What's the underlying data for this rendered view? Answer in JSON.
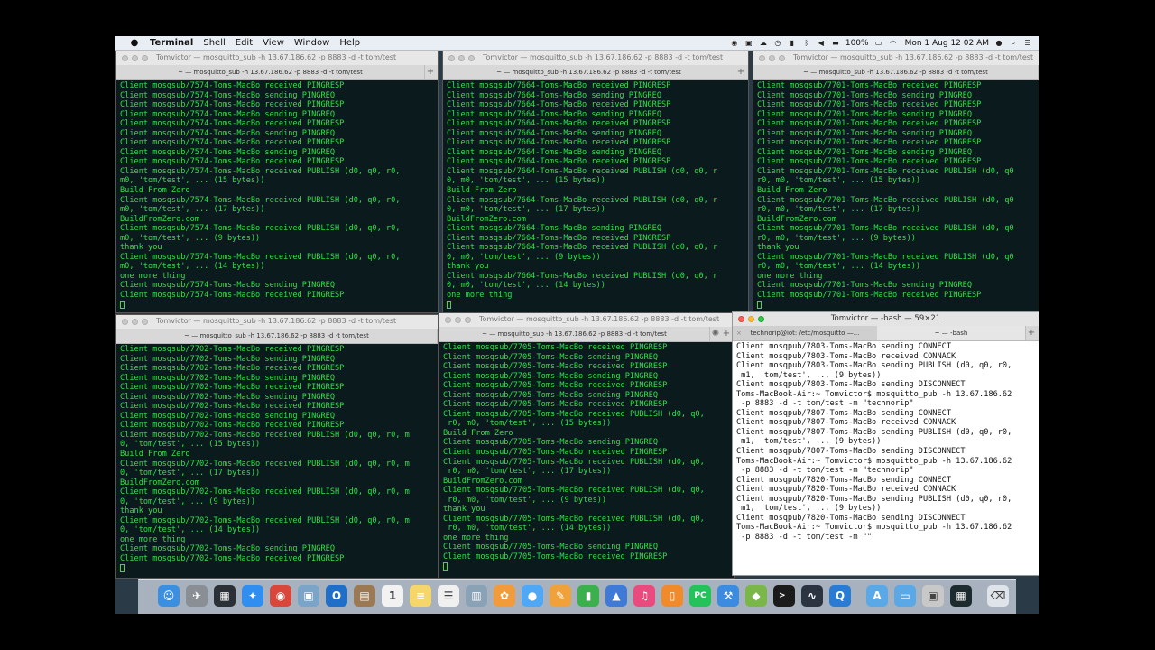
{
  "menubar": {
    "app": "Terminal",
    "items": [
      "Shell",
      "Edit",
      "View",
      "Window",
      "Help"
    ],
    "battery": "100%",
    "datetime": "Mon 1 Aug  12 02 AM"
  },
  "windows": {
    "t1": {
      "title": "Tomvictor — mosquitto_sub -h 13.67.186.62 -p 8883 -d -t tom/test",
      "tab": "~ — mosquitto_sub -h 13.67.186.62 -p 8883 -d -t tom/test",
      "lines": [
        "Client mosqsub/7574-Toms-MacBo received PINGRESP",
        "Client mosqsub/7574-Toms-MacBo sending PINGREQ",
        "Client mosqsub/7574-Toms-MacBo received PINGRESP",
        "Client mosqsub/7574-Toms-MacBo sending PINGREQ",
        "Client mosqsub/7574-Toms-MacBo received PINGRESP",
        "Client mosqsub/7574-Toms-MacBo sending PINGREQ",
        "Client mosqsub/7574-Toms-MacBo received PINGRESP",
        "Client mosqsub/7574-Toms-MacBo sending PINGREQ",
        "Client mosqsub/7574-Toms-MacBo received PINGRESP",
        "Client mosqsub/7574-Toms-MacBo received PUBLISH (d0, q0, r0,",
        "m0, 'tom/test', ... (15 bytes))",
        "Build From Zero",
        "Client mosqsub/7574-Toms-MacBo received PUBLISH (d0, q0, r0,",
        "m0, 'tom/test', ... (17 bytes))",
        "BuildFromZero.com",
        "Client mosqsub/7574-Toms-MacBo received PUBLISH (d0, q0, r0,",
        "m0, 'tom/test', ... (9 bytes))",
        "thank you",
        "Client mosqsub/7574-Toms-MacBo received PUBLISH (d0, q0, r0,",
        "m0, 'tom/test', ... (14 bytes))",
        "one more thing",
        "Client mosqsub/7574-Toms-MacBo sending PINGREQ",
        "Client mosqsub/7574-Toms-MacBo received PINGRESP"
      ]
    },
    "t2": {
      "title": "Tomvictor — mosquitto_sub -h 13.67.186.62 -p 8883 -d -t tom/test",
      "tab": "~ — mosquitto_sub -h 13.67.186.62 -p 8883 -d -t tom/test",
      "lines": [
        "Client mosqsub/7664-Toms-MacBo received PINGRESP",
        "Client mosqsub/7664-Toms-MacBo sending PINGREQ",
        "Client mosqsub/7664-Toms-MacBo received PINGRESP",
        "Client mosqsub/7664-Toms-MacBo sending PINGREQ",
        "Client mosqsub/7664-Toms-MacBo received PINGRESP",
        "Client mosqsub/7664-Toms-MacBo sending PINGREQ",
        "Client mosqsub/7664-Toms-MacBo received PINGRESP",
        "Client mosqsub/7664-Toms-MacBo sending PINGREQ",
        "Client mosqsub/7664-Toms-MacBo received PINGRESP",
        "Client mosqsub/7664-Toms-MacBo received PUBLISH (d0, q0, r",
        "0, m0, 'tom/test', ... (15 bytes))",
        "Build From Zero",
        "Client mosqsub/7664-Toms-MacBo received PUBLISH (d0, q0, r",
        "0, m0, 'tom/test', ... (17 bytes))",
        "BuildFromZero.com",
        "Client mosqsub/7664-Toms-MacBo sending PINGREQ",
        "Client mosqsub/7664-Toms-MacBo received PINGRESP",
        "Client mosqsub/7664-Toms-MacBo received PUBLISH (d0, q0, r",
        "0, m0, 'tom/test', ... (9 bytes))",
        "thank you",
        "Client mosqsub/7664-Toms-MacBo received PUBLISH (d0, q0, r",
        "0, m0, 'tom/test', ... (14 bytes))",
        "one more thing"
      ]
    },
    "t3": {
      "title": "Tomvictor — mosquitto_sub -h 13.67.186.62 -p 8883 -d -t tom/test",
      "tab": "~ — mosquitto_sub -h 13.67.186.62 -p 8883 -d -t tom/test",
      "lines": [
        "Client mosqsub/7701-Toms-MacBo received PINGRESP",
        "Client mosqsub/7701-Toms-MacBo sending PINGREQ",
        "Client mosqsub/7701-Toms-MacBo received PINGRESP",
        "Client mosqsub/7701-Toms-MacBo sending PINGREQ",
        "Client mosqsub/7701-Toms-MacBo received PINGRESP",
        "Client mosqsub/7701-Toms-MacBo sending PINGREQ",
        "Client mosqsub/7701-Toms-MacBo received PINGRESP",
        "Client mosqsub/7701-Toms-MacBo sending PINGREQ",
        "Client mosqsub/7701-Toms-MacBo received PINGRESP",
        "Client mosqsub/7701-Toms-MacBo received PUBLISH (d0, q0",
        "r0, m0, 'tom/test', ... (15 bytes))",
        "Build From Zero",
        "Client mosqsub/7701-Toms-MacBo received PUBLISH (d0, q0",
        "r0, m0, 'tom/test', ... (17 bytes))",
        "BuildFromZero.com",
        "Client mosqsub/7701-Toms-MacBo received PUBLISH (d0, q0",
        "r0, m0, 'tom/test', ... (9 bytes))",
        "thank you",
        "Client mosqsub/7701-Toms-MacBo received PUBLISH (d0, q0",
        "r0, m0, 'tom/test', ... (14 bytes))",
        "one more thing",
        "Client mosqsub/7701-Toms-MacBo sending PINGREQ",
        "Client mosqsub/7701-Toms-MacBo received PINGRESP"
      ]
    },
    "t4": {
      "title": "Tomvictor — mosquitto_sub -h 13.67.186.62 -p 8883 -d -t tom/test",
      "tab": "~ — mosquitto_sub -h 13.67.186.62 -p 8883 -d -t tom/test",
      "lines": [
        "Client mosqsub/7702-Toms-MacBo received PINGRESP",
        "Client mosqsub/7702-Toms-MacBo sending PINGREQ",
        "Client mosqsub/7702-Toms-MacBo received PINGRESP",
        "Client mosqsub/7702-Toms-MacBo sending PINGREQ",
        "Client mosqsub/7702-Toms-MacBo received PINGRESP",
        "Client mosqsub/7702-Toms-MacBo sending PINGREQ",
        "Client mosqsub/7702-Toms-MacBo received PINGRESP",
        "Client mosqsub/7702-Toms-MacBo sending PINGREQ",
        "Client mosqsub/7702-Toms-MacBo received PINGRESP",
        "Client mosqsub/7702-Toms-MacBo received PUBLISH (d0, q0, r0, m",
        "0, 'tom/test', ... (15 bytes))",
        "Build From Zero",
        "Client mosqsub/7702-Toms-MacBo received PUBLISH (d0, q0, r0, m",
        "0, 'tom/test', ... (17 bytes))",
        "BuildFromZero.com",
        "Client mosqsub/7702-Toms-MacBo received PUBLISH (d0, q0, r0, m",
        "0, 'tom/test', ... (9 bytes))",
        "thank you",
        "Client mosqsub/7702-Toms-MacBo received PUBLISH (d0, q0, r0, m",
        "0, 'tom/test', ... (14 bytes))",
        "one more thing",
        "Client mosqsub/7702-Toms-MacBo sending PINGREQ",
        "Client mosqsub/7702-Toms-MacBo received PINGRESP"
      ]
    },
    "t5": {
      "title": "Tomvictor — mosquitto_sub -h 13.67.186.62 -p 8883 -d -t tom/test",
      "tab": "~ — mosquitto_sub -h 13.67.186.62 -p 8883 -d -t tom/test",
      "lines": [
        "Client mosqsub/7705-Toms-MacBo received PINGRESP",
        "Client mosqsub/7705-Toms-MacBo sending PINGREQ",
        "Client mosqsub/7705-Toms-MacBo received PINGRESP",
        "Client mosqsub/7705-Toms-MacBo sending PINGREQ",
        "Client mosqsub/7705-Toms-MacBo received PINGRESP",
        "Client mosqsub/7705-Toms-MacBo sending PINGREQ",
        "Client mosqsub/7705-Toms-MacBo received PINGRESP",
        "Client mosqsub/7705-Toms-MacBo received PUBLISH (d0, q0,",
        " r0, m0, 'tom/test', ... (15 bytes))",
        "Build From Zero",
        "Client mosqsub/7705-Toms-MacBo sending PINGREQ",
        "Client mosqsub/7705-Toms-MacBo received PINGRESP",
        "Client mosqsub/7705-Toms-MacBo received PUBLISH (d0, q0,",
        " r0, m0, 'tom/test', ... (17 bytes))",
        "BuildFromZero.com",
        "Client mosqsub/7705-Toms-MacBo received PUBLISH (d0, q0,",
        " r0, m0, 'tom/test', ... (9 bytes))",
        "thank you",
        "Client mosqsub/7705-Toms-MacBo received PUBLISH (d0, q0,",
        " r0, m0, 'tom/test', ... (14 bytes))",
        "one more thing",
        "Client mosqsub/7705-Toms-MacBo sending PINGREQ",
        "Client mosqsub/7705-Toms-MacBo received PINGRESP"
      ]
    },
    "bash": {
      "title": "Tomvictor — -bash — 59×21",
      "tabs": [
        "technorip@iot: /etc/mosquitto —...",
        "~ — -bash"
      ],
      "lines": [
        "Client mosqpub/7803-Toms-MacBo sending CONNECT",
        "Client mosqpub/7803-Toms-MacBo received CONNACK",
        "Client mosqpub/7803-Toms-MacBo sending PUBLISH (d0, q0, r0,",
        " m1, 'tom/test', ... (9 bytes))",
        "Client mosqpub/7803-Toms-MacBo sending DISCONNECT",
        "Toms-MacBook-Air:~ Tomvictor$ mosquitto_pub -h 13.67.186.62",
        " -p 8883 -d -t tom/test -m \"technorip\"",
        "Client mosqpub/7807-Toms-MacBo sending CONNECT",
        "Client mosqpub/7807-Toms-MacBo received CONNACK",
        "Client mosqpub/7807-Toms-MacBo sending PUBLISH (d0, q0, r0,",
        " m1, 'tom/test', ... (9 bytes))",
        "Client mosqpub/7807-Toms-MacBo sending DISCONNECT",
        "Toms-MacBook-Air:~ Tomvictor$ mosquitto_pub -h 13.67.186.62",
        " -p 8883 -d -t tom/test -m \"technorip\"",
        "Client mosqpub/7820-Toms-MacBo sending CONNECT",
        "Client mosqpub/7820-Toms-MacBo received CONNACK",
        "Client mosqpub/7820-Toms-MacBo sending PUBLISH (d0, q0, r0,",
        " m1, 'tom/test', ... (9 bytes))",
        "Client mosqpub/7820-Toms-MacBo sending DISCONNECT",
        "Toms-MacBook-Air:~ Tomvictor$ mosquitto_pub -h 13.67.186.62",
        " -p 8883 -d -t tom/test -m \"\""
      ]
    }
  },
  "dock": {
    "apps": [
      {
        "name": "finder",
        "color": "#3a8fe0",
        "glyph": "☺"
      },
      {
        "name": "launchpad",
        "color": "#8a8f96",
        "glyph": "✈"
      },
      {
        "name": "mission-control",
        "color": "#2b2f36",
        "glyph": "▦"
      },
      {
        "name": "safari",
        "color": "#2f8ef0",
        "glyph": "✦"
      },
      {
        "name": "chrome",
        "color": "#d9463a",
        "glyph": "◉"
      },
      {
        "name": "preview",
        "color": "#7aa4c8",
        "glyph": "▣"
      },
      {
        "name": "outlook",
        "color": "#1f6fc8",
        "glyph": "O"
      },
      {
        "name": "contacts",
        "color": "#9b7a53",
        "glyph": "▤"
      },
      {
        "name": "calendar",
        "color": "#f2f2f2",
        "glyph": "1"
      },
      {
        "name": "notes",
        "color": "#f5d66a",
        "glyph": "≡"
      },
      {
        "name": "reminders",
        "color": "#f0f0f0",
        "glyph": "☰"
      },
      {
        "name": "image-capture",
        "color": "#8aa2b5",
        "glyph": "▥"
      },
      {
        "name": "photos",
        "color": "#f29b3a",
        "glyph": "✿"
      },
      {
        "name": "messages",
        "color": "#4fa8f5",
        "glyph": "●"
      },
      {
        "name": "pages",
        "color": "#f0a13a",
        "glyph": "✎"
      },
      {
        "name": "numbers",
        "color": "#3cb04d",
        "glyph": "▮"
      },
      {
        "name": "keynote",
        "color": "#3f7ad6",
        "glyph": "▲"
      },
      {
        "name": "itunes",
        "color": "#e94b7f",
        "glyph": "♫"
      },
      {
        "name": "ibooks",
        "color": "#f18a2a",
        "glyph": "▯"
      },
      {
        "name": "pycharm",
        "color": "#23c25a",
        "glyph": "PC"
      },
      {
        "name": "xcode",
        "color": "#3b8be0",
        "glyph": "⚒"
      },
      {
        "name": "android-studio",
        "color": "#7ab648",
        "glyph": "◆"
      },
      {
        "name": "terminal",
        "color": "#1b1b1b",
        "glyph": ">_"
      },
      {
        "name": "activity-monitor",
        "color": "#2b3440",
        "glyph": "∿"
      },
      {
        "name": "quicktime",
        "color": "#2a7bd4",
        "glyph": "Q"
      },
      {
        "name": "applications-folder",
        "color": "#5aa9e6",
        "glyph": "A"
      },
      {
        "name": "documents-folder",
        "color": "#5aa9e6",
        "glyph": "▭"
      },
      {
        "name": "downloads-stack",
        "color": "#c8c8c8",
        "glyph": "▣"
      },
      {
        "name": "console",
        "color": "#1d2a2e",
        "glyph": "▦"
      },
      {
        "name": "trash",
        "color": "#dfe4ea",
        "glyph": "⌫"
      }
    ]
  }
}
